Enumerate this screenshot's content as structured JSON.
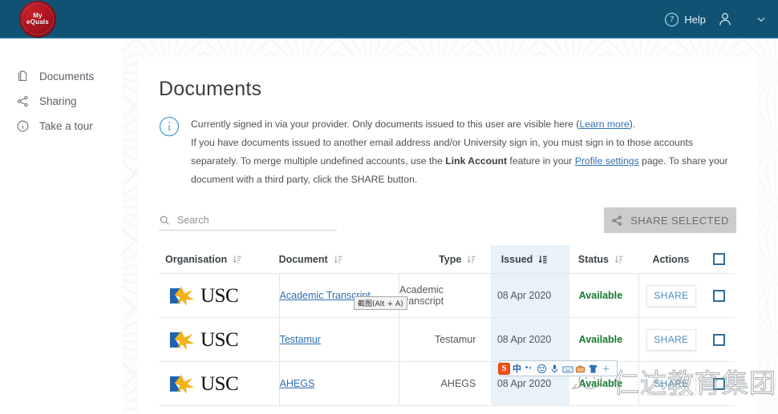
{
  "header": {
    "logo_line1": "My",
    "logo_line2": "eQuals",
    "logo_alt": "my-equals-seal",
    "help_label": "Help",
    "help_icon": "question-circle-icon",
    "account_icon": "person-icon",
    "user_name": "",
    "chevron_icon": "chevron-down-icon",
    "bg_color": "#0f5274"
  },
  "sidebar": {
    "items": [
      {
        "label": "Documents",
        "icon": "documents-icon"
      },
      {
        "label": "Sharing",
        "icon": "share-nodes-icon"
      },
      {
        "label": "Take a tour",
        "icon": "info-circle-icon"
      }
    ]
  },
  "main": {
    "title": "Documents",
    "banner": {
      "icon": "info-circle-icon",
      "line1_pre": "Currently signed in via your provider. Only documents issued to this user are visible here (",
      "line1_link": "Learn more",
      "line1_post": ").",
      "line2_pre": "If you have documents issued to another email address and/or University sign in, you must sign in to those accounts separately. To merge multiple undefined accounts, use the ",
      "line2_bold": "Link Account",
      "line2_mid": " feature in your ",
      "line2_link": "Profile settings",
      "line2_post": " page. To share your document with a third party, click the SHARE button."
    },
    "search": {
      "icon": "search-icon",
      "placeholder": "Search",
      "value": ""
    },
    "share_selected": {
      "label": "SHARE SELECTED",
      "icon": "share-nodes-icon",
      "disabled": true,
      "bg_color": "#cccccc"
    }
  },
  "table": {
    "columns": [
      {
        "label": "Organisation",
        "sort_icon": "sort-icon",
        "active": false
      },
      {
        "label": "Document",
        "sort_icon": "sort-icon",
        "active": false
      },
      {
        "label": "Type",
        "sort_icon": "sort-icon",
        "active": false
      },
      {
        "label": "Issued",
        "sort_icon": "sort-desc-icon",
        "active": true
      },
      {
        "label": "Status",
        "sort_icon": "sort-icon",
        "active": false
      },
      {
        "label": "Actions",
        "sort_icon": "",
        "active": false
      }
    ],
    "select_all_checked": false,
    "highlight_color": "#e8f2f8",
    "rows": [
      {
        "org": "USC",
        "document": "Academic Transcript",
        "type": "Academic Transcript",
        "issued": "08 Apr 2020",
        "status": "Available",
        "action": "SHARE",
        "checked": false
      },
      {
        "org": "USC",
        "document": "Testamur",
        "type": "Testamur",
        "issued": "08 Apr 2020",
        "status": "Available",
        "action": "SHARE",
        "checked": false
      },
      {
        "org": "USC",
        "document": "AHEGS",
        "type": "AHEGS",
        "issued": "08 Apr 2020",
        "status": "Available",
        "action": "SHARE",
        "checked": false
      }
    ]
  },
  "overlays": {
    "snip_tooltip": "截图(Alt + A)",
    "ime": {
      "logo": "S",
      "mode": "中",
      "icons": [
        "punctuation-icon",
        "emoji-icon",
        "microphone-icon",
        "soft-keyboard-icon",
        "toolbox-icon",
        "skin-shirt-icon",
        "more-icon"
      ]
    },
    "watermark": {
      "text": "仁达教育集团",
      "icon": "chat-bubble-icon"
    }
  }
}
